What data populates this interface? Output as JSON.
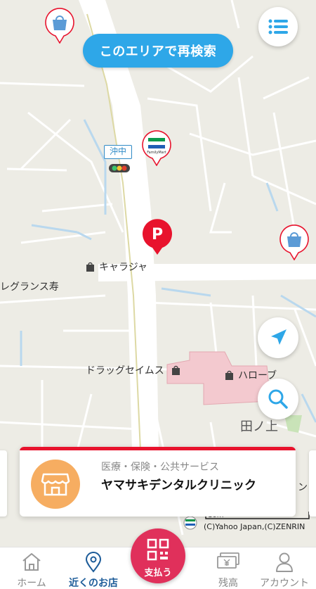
{
  "map": {
    "search_area_label": "このエリアで再検索",
    "station_name": "沖中",
    "place_labels": {
      "kyarajya": "キャラジャ",
      "reglance": "レグランス寿",
      "drug": "ドラッグセイムス",
      "harobu": "ハローブ",
      "tanoue": "田ノ上",
      "right_edge": "ン"
    },
    "familymart_text": "FamilyMart",
    "paypay_letter": "P",
    "scale_text": "10m",
    "copyright": "(C)Yahoo Japan,(C)ZENRIN"
  },
  "info_card": {
    "category": "医療・保険・公共サービス",
    "name": "ヤマサキデンタルクリニック"
  },
  "tabs": {
    "home": "ホーム",
    "nearby": "近くのお店",
    "pay": "支払う",
    "balance": "残高",
    "account": "アカウント"
  },
  "colors": {
    "accent_blue": "#2ea7e8",
    "active_tab": "#1d5c99",
    "pay_red": "#e0305b",
    "card_red": "#e8132d",
    "shop_orange": "#f6ad61"
  }
}
